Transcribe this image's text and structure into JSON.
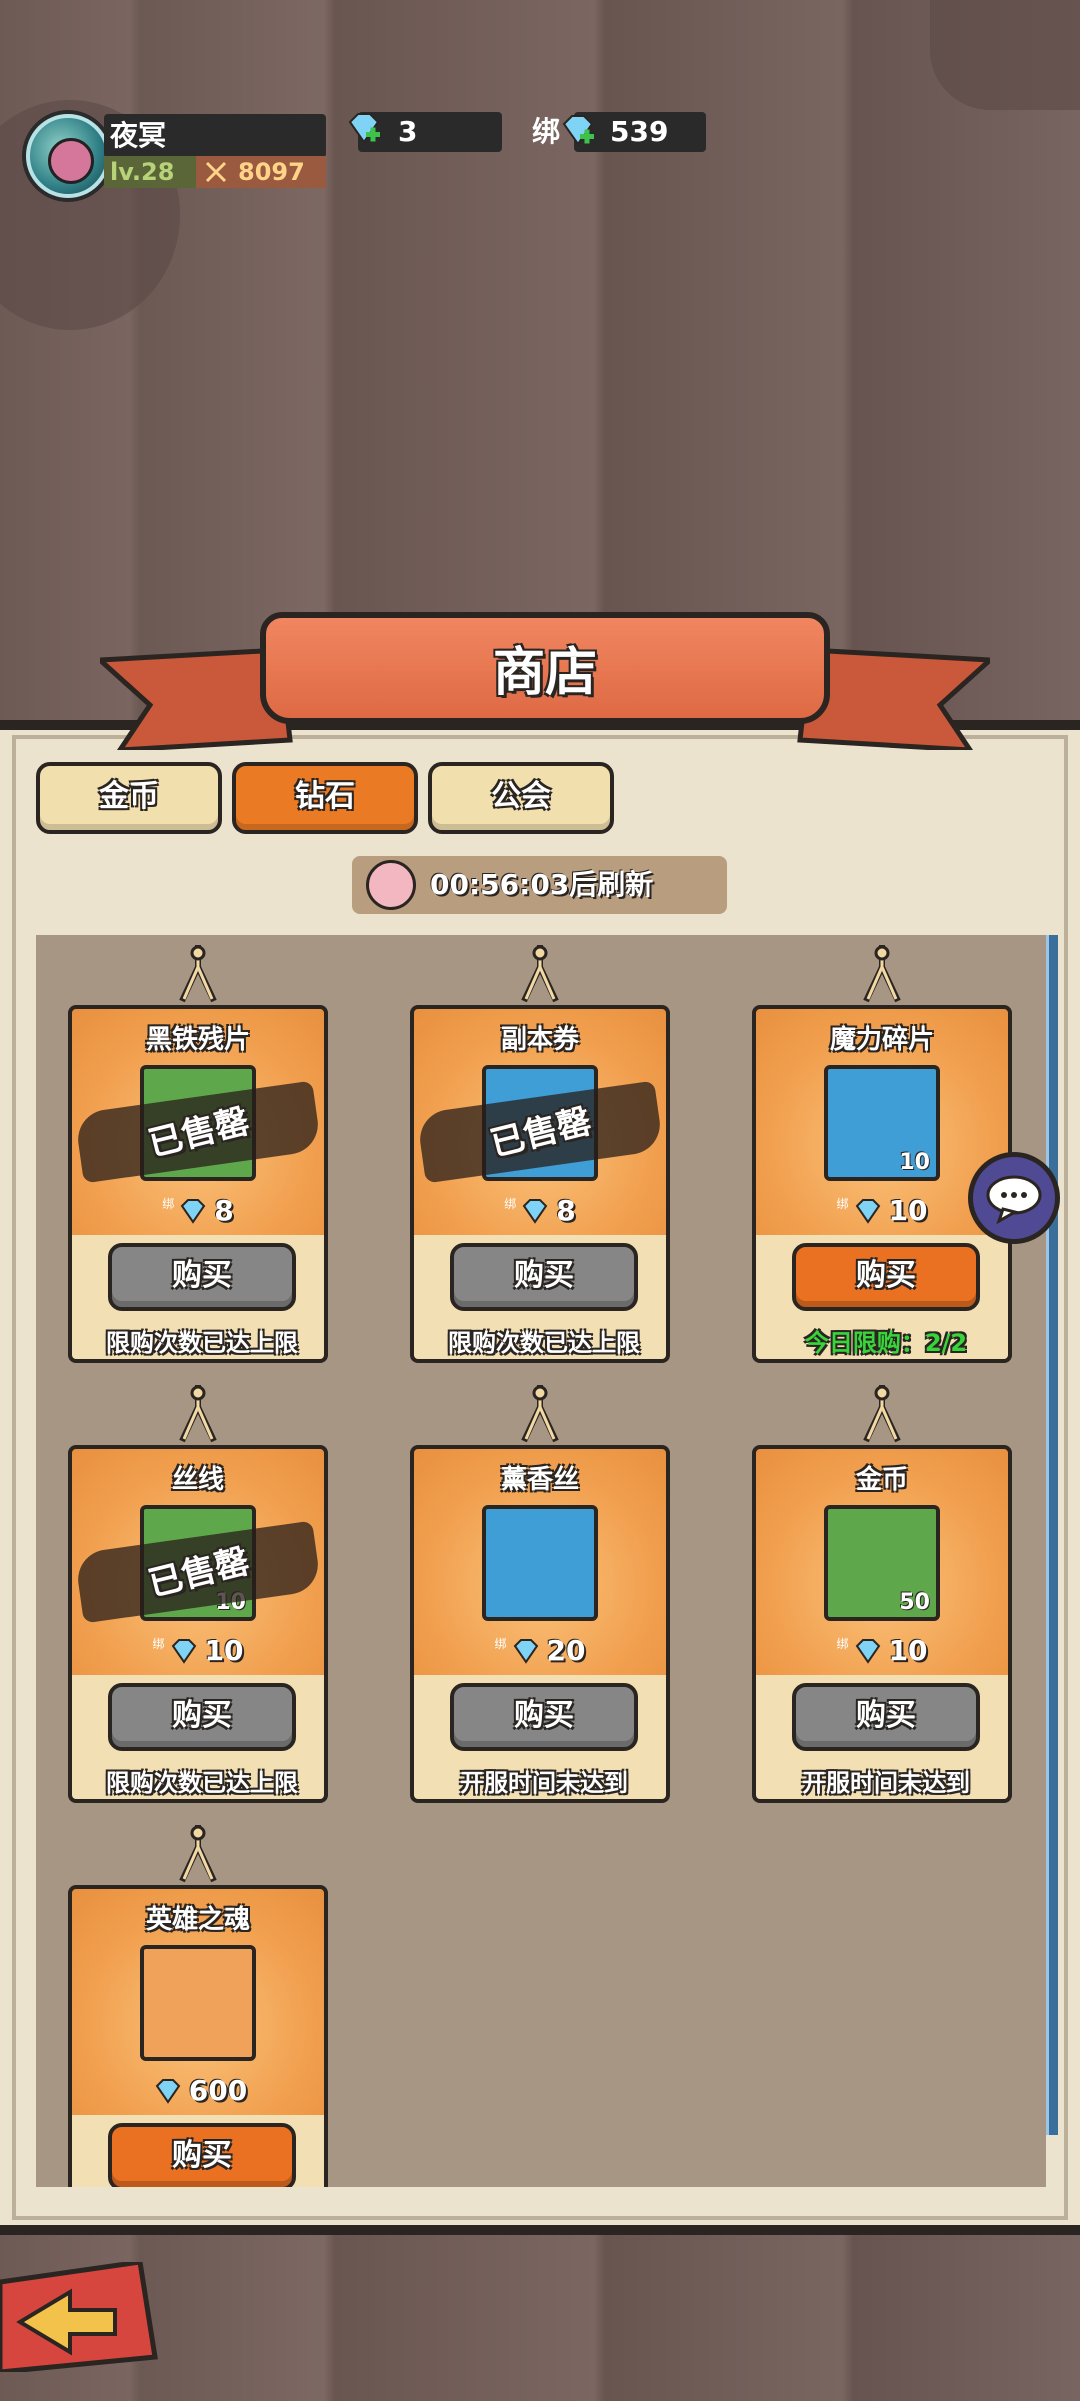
{
  "player": {
    "name": "夜冥",
    "level": "lv.28",
    "power": "8097"
  },
  "currency": {
    "diamonds": "3",
    "bound_label": "绑",
    "bound_diamonds": "539"
  },
  "shop": {
    "title": "商店",
    "tabs": [
      {
        "label": "金币",
        "active": false
      },
      {
        "label": "钻石",
        "active": true
      },
      {
        "label": "公会",
        "active": false
      }
    ],
    "refresh_timer": "00:56:03后刷新",
    "items": [
      {
        "name": "黑铁残片",
        "bind_tag": "绑",
        "price": "8",
        "qty": "",
        "sold_out": true,
        "sold_out_label": "已售罄",
        "buy_label": "购买",
        "buy_enabled": false,
        "note": "限购次数已达上限",
        "icon": "iron-fragment-icon",
        "bg": "#5ea84b"
      },
      {
        "name": "副本券",
        "bind_tag": "绑",
        "price": "8",
        "qty": "",
        "sold_out": true,
        "sold_out_label": "已售罄",
        "buy_label": "购买",
        "buy_enabled": false,
        "note": "限购次数已达上限",
        "icon": "dungeon-ticket-icon",
        "bg": "#3f9ed6"
      },
      {
        "name": "魔力碎片",
        "bind_tag": "绑",
        "price": "10",
        "qty": "10",
        "sold_out": false,
        "buy_label": "购买",
        "buy_enabled": true,
        "note": "今日限购：2/2",
        "icon": "magic-shard-icon",
        "bg": "#3f9ed6"
      },
      {
        "name": "丝线",
        "bind_tag": "绑",
        "price": "10",
        "qty": "10",
        "sold_out": true,
        "sold_out_label": "已售罄",
        "buy_label": "购买",
        "buy_enabled": false,
        "note": "限购次数已达上限",
        "icon": "thread-icon",
        "bg": "#5ea84b"
      },
      {
        "name": "薰香丝",
        "bind_tag": "绑",
        "price": "20",
        "qty": "",
        "sold_out": false,
        "buy_label": "购买",
        "buy_enabled": false,
        "note": "开服时间未达到",
        "icon": "yarn-ball-icon",
        "bg": "#3f9ed6"
      },
      {
        "name": "金币",
        "bind_tag": "绑",
        "price": "10",
        "qty": "50",
        "sold_out": false,
        "buy_label": "购买",
        "buy_enabled": false,
        "note": "开服时间未达到",
        "icon": "gold-coin-icon",
        "bg": "#5ea84b"
      },
      {
        "name": "英雄之魂",
        "bind_tag": "",
        "price": "600",
        "qty": "",
        "sold_out": false,
        "buy_label": "购买",
        "buy_enabled": true,
        "note": "",
        "icon": "hero-soul-icon",
        "bg": "#f0a25a"
      }
    ]
  },
  "colors": {
    "accent": "#ea7122",
    "panel": "#ece3cf",
    "ribbon": "#e8744c",
    "disabled": "#868686",
    "limit_green": "#37d43a"
  }
}
